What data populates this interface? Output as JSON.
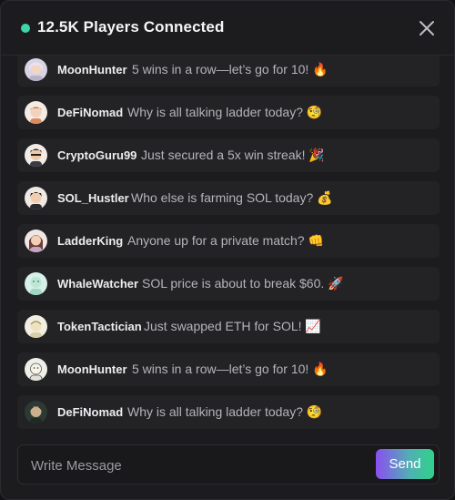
{
  "header": {
    "status_text": "12.5K Players Connected",
    "status_color": "#3ed6a8",
    "close_icon": "close-icon"
  },
  "messages": [
    {
      "user": "MoonHunter",
      "text": "5 wins in a row—let’s go for 10! 🔥",
      "avatar": "avatar-moonhunter"
    },
    {
      "user": "DeFiNomad",
      "text": "Why is all talking ladder today? 🧐",
      "avatar": "avatar-definomad"
    },
    {
      "user": "CryptoGuru99",
      "text": "Just secured a 5x win streak! 🎉",
      "avatar": "avatar-cryptoguru"
    },
    {
      "user": "SOL_Hustler",
      "text": "Who else is farming SOL today? 💰",
      "avatar": "avatar-solhustler"
    },
    {
      "user": "LadderKing",
      "text": "Anyone up for a private match? 👊",
      "avatar": "avatar-ladderking"
    },
    {
      "user": "WhaleWatcher",
      "text": "SOL price is about to break $60. 🚀",
      "avatar": "avatar-whalewatcher"
    },
    {
      "user": "TokenTactician",
      "text": "Just swapped ETH for SOL! 📈",
      "avatar": "avatar-tokentactician"
    },
    {
      "user": "MoonHunter",
      "text": "5 wins in a row—let’s go for 10! 🔥",
      "avatar": "avatar-moonhunter"
    },
    {
      "user": "DeFiNomad",
      "text": "Why is all talking ladder today? 🧐",
      "avatar": "avatar-definomad"
    }
  ],
  "composer": {
    "placeholder": "Write Message",
    "value": "",
    "send_label": "Send"
  }
}
